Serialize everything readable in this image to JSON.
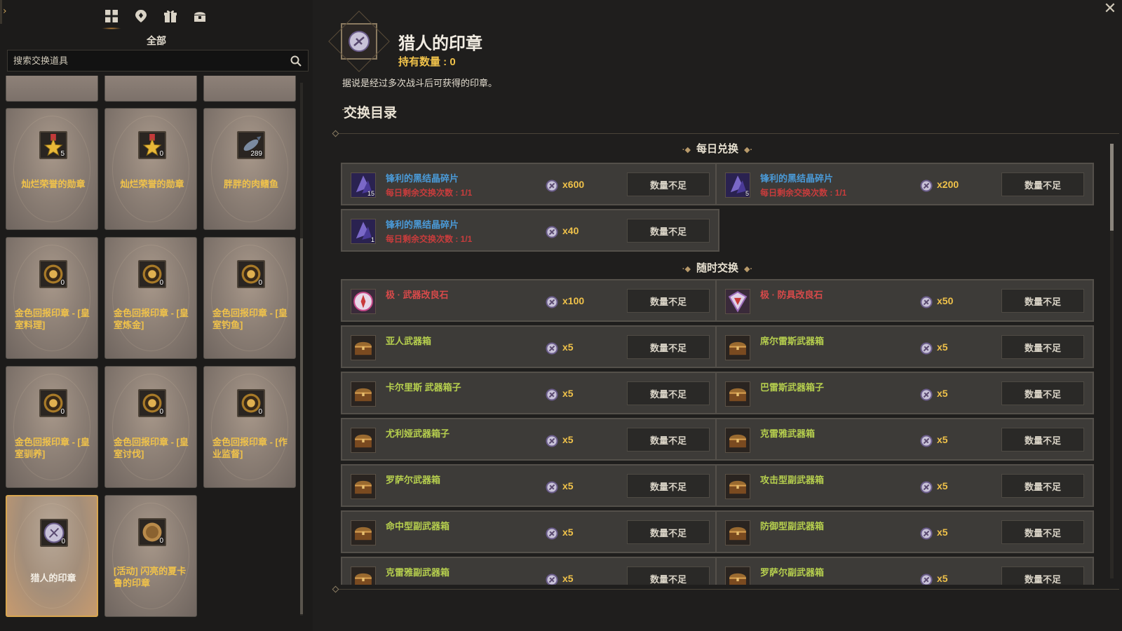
{
  "left": {
    "category_label": "全部",
    "search_placeholder": "搜索交换道具",
    "cards": [
      {
        "name": "灿烂荣誉的勋章",
        "count": "5",
        "icon": "star-medal-icon",
        "name_color": "gold"
      },
      {
        "name": "灿烂荣誉的勋章",
        "count": "0",
        "icon": "star-medal-icon",
        "name_color": "gold"
      },
      {
        "name": "胖胖的肉鳍鱼",
        "count": "289",
        "icon": "fish-icon",
        "name_color": "gold"
      },
      {
        "name": "金色回报印章 - [皇室料理]",
        "count": "0",
        "icon": "gold-seal-icon",
        "name_color": "gold"
      },
      {
        "name": "金色回报印章 - [皇室炼金]",
        "count": "0",
        "icon": "gold-seal-icon",
        "name_color": "gold"
      },
      {
        "name": "金色回报印章 - [皇室钓鱼]",
        "count": "0",
        "icon": "gold-seal-icon",
        "name_color": "gold"
      },
      {
        "name": "金色回报印章 - [皇室驯养]",
        "count": "0",
        "icon": "gold-seal-icon",
        "name_color": "gold"
      },
      {
        "name": "金色回报印章 - [皇室讨伐]",
        "count": "0",
        "icon": "gold-seal-icon",
        "name_color": "gold"
      },
      {
        "name": "金色回报印章 - [作业监督]",
        "count": "0",
        "icon": "gold-seal-icon",
        "name_color": "gold"
      },
      {
        "name": "猎人的印章",
        "count": "0",
        "icon": "hunter-seal-icon",
        "name_color": "white",
        "selected": true
      },
      {
        "name": "[活动] 闪亮的夏卡鲁的印章",
        "count": "0",
        "icon": "coin-icon",
        "name_color": "gold"
      }
    ]
  },
  "detail": {
    "title": "猎人的印章",
    "held_label": "持有数量 : 0",
    "description": "据说是经过多次战斗后可获得的印章。",
    "section_title": "交换目录",
    "daily_label": "每日兑换",
    "anytime_label": "随时交换",
    "button_label": "数量不足",
    "daily": [
      {
        "name": "锋利的黑结晶碎片",
        "limit": "每日剩余交换次数 : 1/1",
        "cost": "x600",
        "count": "15",
        "icon": "crystal-shard-icon",
        "color": "blue"
      },
      {
        "name": "锋利的黑结晶碎片",
        "limit": "每日剩余交换次数 : 1/1",
        "cost": "x200",
        "count": "5",
        "icon": "crystal-shard-icon",
        "color": "blue"
      },
      {
        "name": "锋利的黑结晶碎片",
        "limit": "每日剩余交换次数 : 1/1",
        "cost": "x40",
        "count": "1",
        "icon": "crystal-shard-icon",
        "color": "blue"
      }
    ],
    "anytime": [
      {
        "name": "极 · 武器改良石",
        "cost": "x100",
        "icon": "weapon-stone-icon",
        "color": "red"
      },
      {
        "name": "极 · 防具改良石",
        "cost": "x50",
        "icon": "armor-stone-icon",
        "color": "red"
      },
      {
        "name": "亚人武器箱",
        "cost": "x5",
        "icon": "chest-icon",
        "color": "green"
      },
      {
        "name": "席尔雷斯武器箱",
        "cost": "x5",
        "icon": "chest-icon",
        "color": "green"
      },
      {
        "name": "卡尔里斯 武器箱子",
        "cost": "x5",
        "icon": "chest-icon",
        "color": "green"
      },
      {
        "name": "巴雷斯武器箱子",
        "cost": "x5",
        "icon": "chest-icon",
        "color": "green"
      },
      {
        "name": "尤利娅武器箱子",
        "cost": "x5",
        "icon": "chest-icon",
        "color": "green"
      },
      {
        "name": "克雷雅武器箱",
        "cost": "x5",
        "icon": "chest-icon",
        "color": "green"
      },
      {
        "name": "罗萨尔武器箱",
        "cost": "x5",
        "icon": "chest-icon",
        "color": "green"
      },
      {
        "name": "攻击型副武器箱",
        "cost": "x5",
        "icon": "chest-icon",
        "color": "green"
      },
      {
        "name": "命中型副武器箱",
        "cost": "x5",
        "icon": "chest-icon",
        "color": "green"
      },
      {
        "name": "防御型副武器箱",
        "cost": "x5",
        "icon": "chest-icon",
        "color": "green"
      },
      {
        "name": "克雷雅副武器箱",
        "cost": "x5",
        "icon": "chest-icon",
        "color": "green"
      },
      {
        "name": "罗萨尔副武器箱",
        "cost": "x5",
        "icon": "chest-icon",
        "color": "green"
      }
    ]
  },
  "colors": {
    "gold": "#f0c24a",
    "blue_name": "#4a9ad8",
    "green_name": "#b6cf4e",
    "red_name": "#d84a4a",
    "limit_red": "#c83c3c"
  }
}
